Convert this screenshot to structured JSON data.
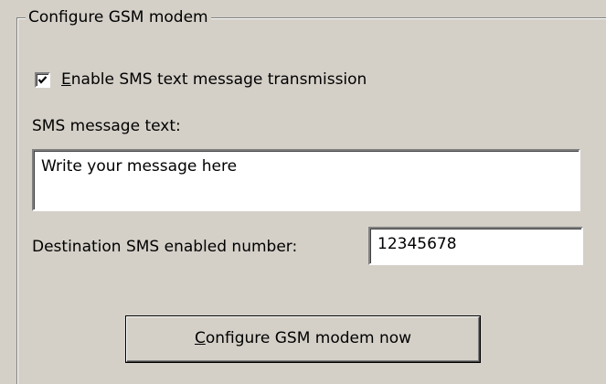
{
  "group": {
    "title": "Configure GSM modem"
  },
  "enable_sms": {
    "checked": true,
    "label_underlined": "E",
    "label_rest": "nable SMS text message transmission"
  },
  "sms_text": {
    "label": "SMS message text:",
    "value": "Write your message here"
  },
  "destination": {
    "label": "Destination SMS enabled number:",
    "value": "12345678"
  },
  "configure_button": {
    "label_underlined": "C",
    "label_rest": "onfigure GSM modem now"
  }
}
